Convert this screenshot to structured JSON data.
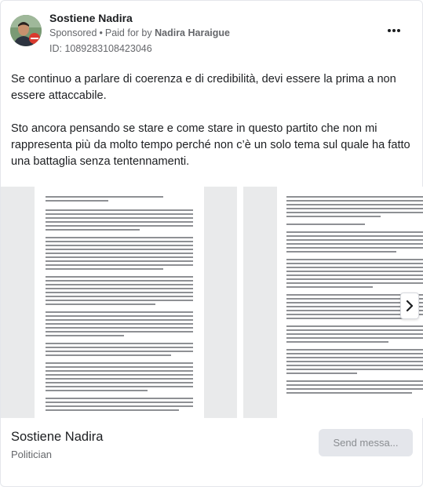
{
  "header": {
    "page_name": "Sostiene Nadira",
    "sponsored": "Sponsored",
    "paid_for_prefix": "Paid for by",
    "payer": "Nadira Haraigue",
    "ad_id": "ID: 1089283108423046",
    "more_icon": "more-horizontal-icon"
  },
  "body": {
    "paragraph_1": "Se continuo a parlare di coerenza e di credibilità, devi essere la prima a non essere attaccabile.",
    "paragraph_2": "Sto ancora pensando se stare e come stare in questo partito che non mi rappresenta più da molto tempo perché non c’è un solo tema sul quale ha fatto una battaglia senza tentennamenti.",
    "ellipsis": "…"
  },
  "carousel": {
    "next_icon": "chevron-right-icon"
  },
  "footer": {
    "title": "Sostiene Nadira",
    "subtitle": "Politician",
    "cta_label": "Send messa..."
  },
  "colors": {
    "text_primary": "#1c1e21",
    "text_secondary": "#65676b",
    "cta_bg": "#e4e6eb"
  }
}
